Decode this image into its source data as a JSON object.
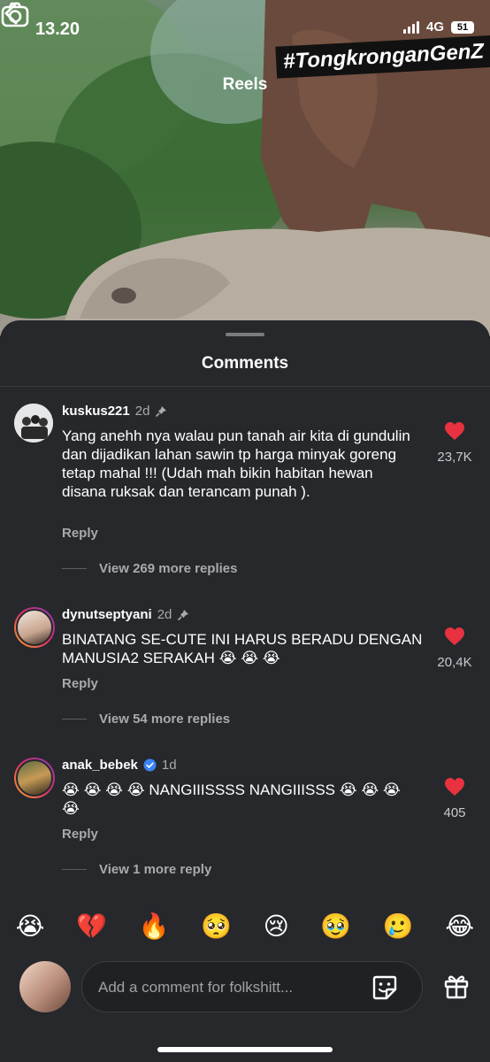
{
  "status_bar": {
    "time": "13.20",
    "network": "4G",
    "battery": "51"
  },
  "video": {
    "overlay_text": "#TongkronganGenZ"
  },
  "header": {
    "title": "Reels",
    "back_icon": "chevron-left-icon",
    "camera_icon": "camera-icon"
  },
  "sheet": {
    "title": "Comments"
  },
  "comments": [
    {
      "username": "kuskus221",
      "time": "2d",
      "pinned": true,
      "text": "Yang anehh nya walau pun tanah air kita di gundulin dan dijadikan lahan sawin tp harga minyak goreng tetap mahal !!! (Udah mah bikin habitan hewan disana ruksak dan terancam punah ).",
      "reply_label": "Reply",
      "more_replies": "View 269 more replies",
      "likes": "23,7K"
    },
    {
      "username": "dynutseptyani",
      "time": "2d",
      "pinned": true,
      "text": "BINATANG SE-CUTE INI HARUS BERADU DENGAN MANUSIA2 SERAKAH 😭 😭 😭",
      "reply_label": "Reply",
      "more_replies": "View 54 more replies",
      "likes": "20,4K"
    },
    {
      "username": "anak_bebek",
      "time": "1d",
      "verified": true,
      "text": "😭 😭 😭 😭  NANGIIISSSS NANGIIISSS 😭 😭 😭 😭",
      "reply_label": "Reply",
      "more_replies": "View 1 more reply",
      "likes": "405"
    }
  ],
  "emoji_bar": [
    "😭",
    "💔",
    "🔥",
    "🥺",
    "😢",
    "🥹",
    "🥲",
    "😂"
  ],
  "composer": {
    "placeholder": "Add a comment for folkshitt...",
    "value": ""
  },
  "colors": {
    "sheet_bg": "#26282c",
    "like_red": "#e8323f",
    "muted_text": "#a8aaad"
  }
}
